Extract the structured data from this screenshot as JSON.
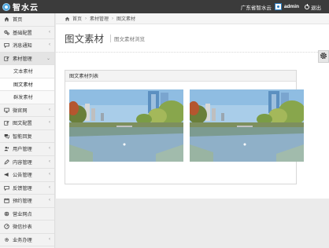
{
  "topbar": {
    "brand_name": "智水云",
    "org_name": "广东省智水云",
    "username": "admin",
    "logout_label": "退出"
  },
  "sidebar": {
    "items": [
      {
        "label": "首页",
        "icon": "home-icon",
        "has_children": false
      },
      {
        "label": "基础配置",
        "icon": "gears-icon",
        "has_children": true
      },
      {
        "label": "消息通知",
        "icon": "comment-icon",
        "has_children": true
      },
      {
        "label": "素材管理",
        "icon": "edit-icon",
        "has_children": true,
        "open": true,
        "children": [
          {
            "label": "文本素材"
          },
          {
            "label": "图文素材",
            "active": true
          },
          {
            "label": "群发素材"
          }
        ]
      },
      {
        "label": "微官网",
        "icon": "desktop-icon",
        "has_children": true
      },
      {
        "label": "图文配置",
        "icon": "edit-icon",
        "has_children": true
      },
      {
        "label": "智能回复",
        "icon": "comments-icon",
        "has_children": false
      },
      {
        "label": "用户管理",
        "icon": "users-icon",
        "has_children": true
      },
      {
        "label": "内容管理",
        "icon": "pencil-icon",
        "has_children": true
      },
      {
        "label": "公告管理",
        "icon": "bullhorn-icon",
        "has_children": true
      },
      {
        "label": "反馈管理",
        "icon": "comment-icon",
        "has_children": true
      },
      {
        "label": "预约管理",
        "icon": "calendar-icon",
        "has_children": true
      },
      {
        "label": "营业网点",
        "icon": "globe-icon",
        "has_children": false
      },
      {
        "label": "微信抄表",
        "icon": "gauge-icon",
        "has_children": false
      },
      {
        "label": "业务办理",
        "icon": "cog-icon",
        "has_children": true
      }
    ]
  },
  "breadcrumb": {
    "items": [
      "首页",
      "素材管理",
      "图文素材"
    ]
  },
  "page": {
    "title": "图文素材",
    "subtitle": "图文素材浏览"
  },
  "panel": {
    "heading": "图文素材列表",
    "thumbnails": [
      {
        "description_icon": "river-city-photo"
      },
      {
        "description_icon": "river-city-photo"
      }
    ]
  },
  "colors": {
    "topbar_bg": "#3b3b3b",
    "sidebar_bg": "#f2f2f2",
    "accent": "#4aa6e0"
  }
}
